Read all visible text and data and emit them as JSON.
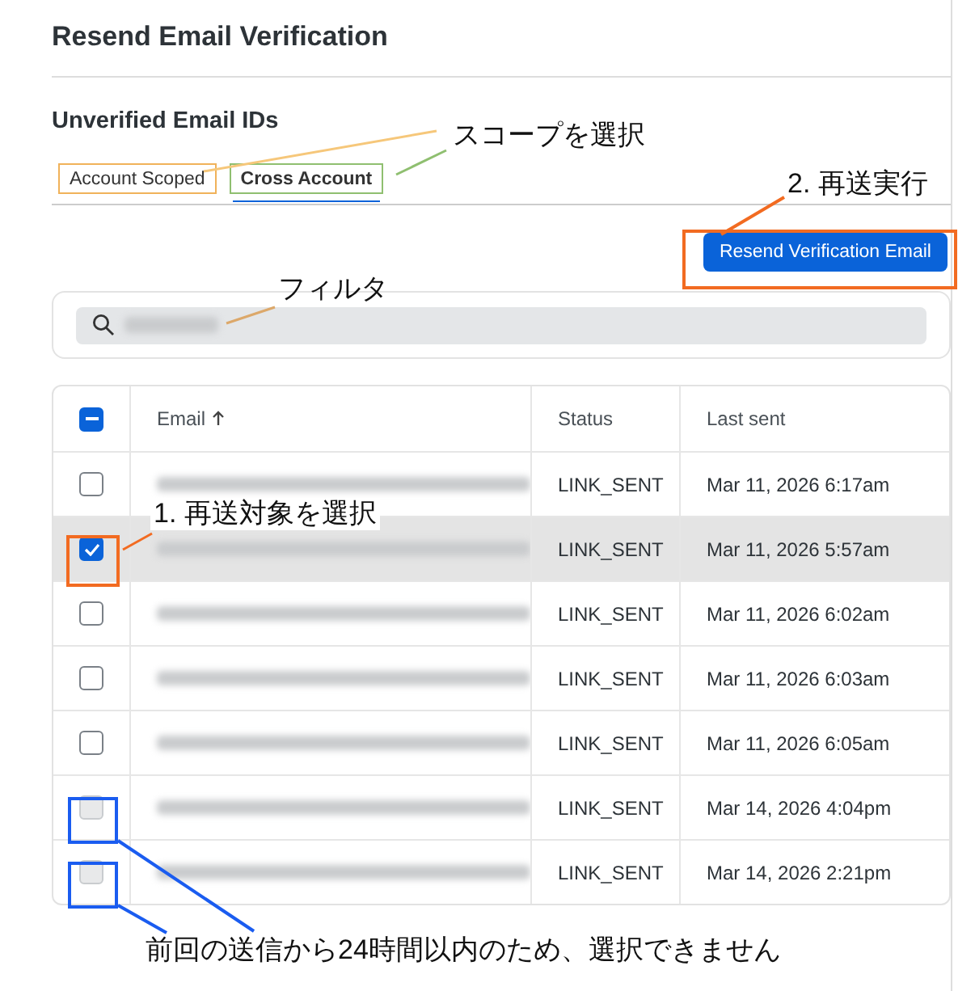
{
  "title": "Resend Email Verification",
  "section_title": "Unverified Email IDs",
  "tabs": [
    {
      "label": "Account Scoped",
      "selected": false,
      "color": "#f0b25a"
    },
    {
      "label": "Cross Account",
      "selected": true,
      "color": "#8fbf70"
    }
  ],
  "resend_button": "Resend Verification Email",
  "table": {
    "select_all": {
      "indeterminate": true
    },
    "columns": [
      {
        "label": "Email",
        "sorted": true
      },
      {
        "label": "Status",
        "sorted": false
      },
      {
        "label": "Last sent",
        "sorted": false
      }
    ],
    "rows": [
      {
        "checked": false,
        "disabled": false,
        "status": "LINK_SENT",
        "last_sent": "Mar 11, 2026 6:17am"
      },
      {
        "checked": true,
        "disabled": false,
        "status": "LINK_SENT",
        "last_sent": "Mar 11, 2026 5:57am"
      },
      {
        "checked": false,
        "disabled": false,
        "status": "LINK_SENT",
        "last_sent": "Mar 11, 2026 6:02am"
      },
      {
        "checked": false,
        "disabled": false,
        "status": "LINK_SENT",
        "last_sent": "Mar 11, 2026 6:03am"
      },
      {
        "checked": false,
        "disabled": false,
        "status": "LINK_SENT",
        "last_sent": "Mar 11, 2026 6:05am"
      },
      {
        "checked": false,
        "disabled": true,
        "status": "LINK_SENT",
        "last_sent": "Mar 14, 2026 4:04pm"
      },
      {
        "checked": false,
        "disabled": true,
        "status": "LINK_SENT",
        "last_sent": "Mar 14, 2026 2:21pm"
      }
    ]
  },
  "notes": {
    "scope": "スコープを選択",
    "resend": "2. 再送実行",
    "filter": "フィルタ",
    "select": "1. 再送対象を選択",
    "disabled": "前回の送信から24時間以内のため、選択できません"
  }
}
